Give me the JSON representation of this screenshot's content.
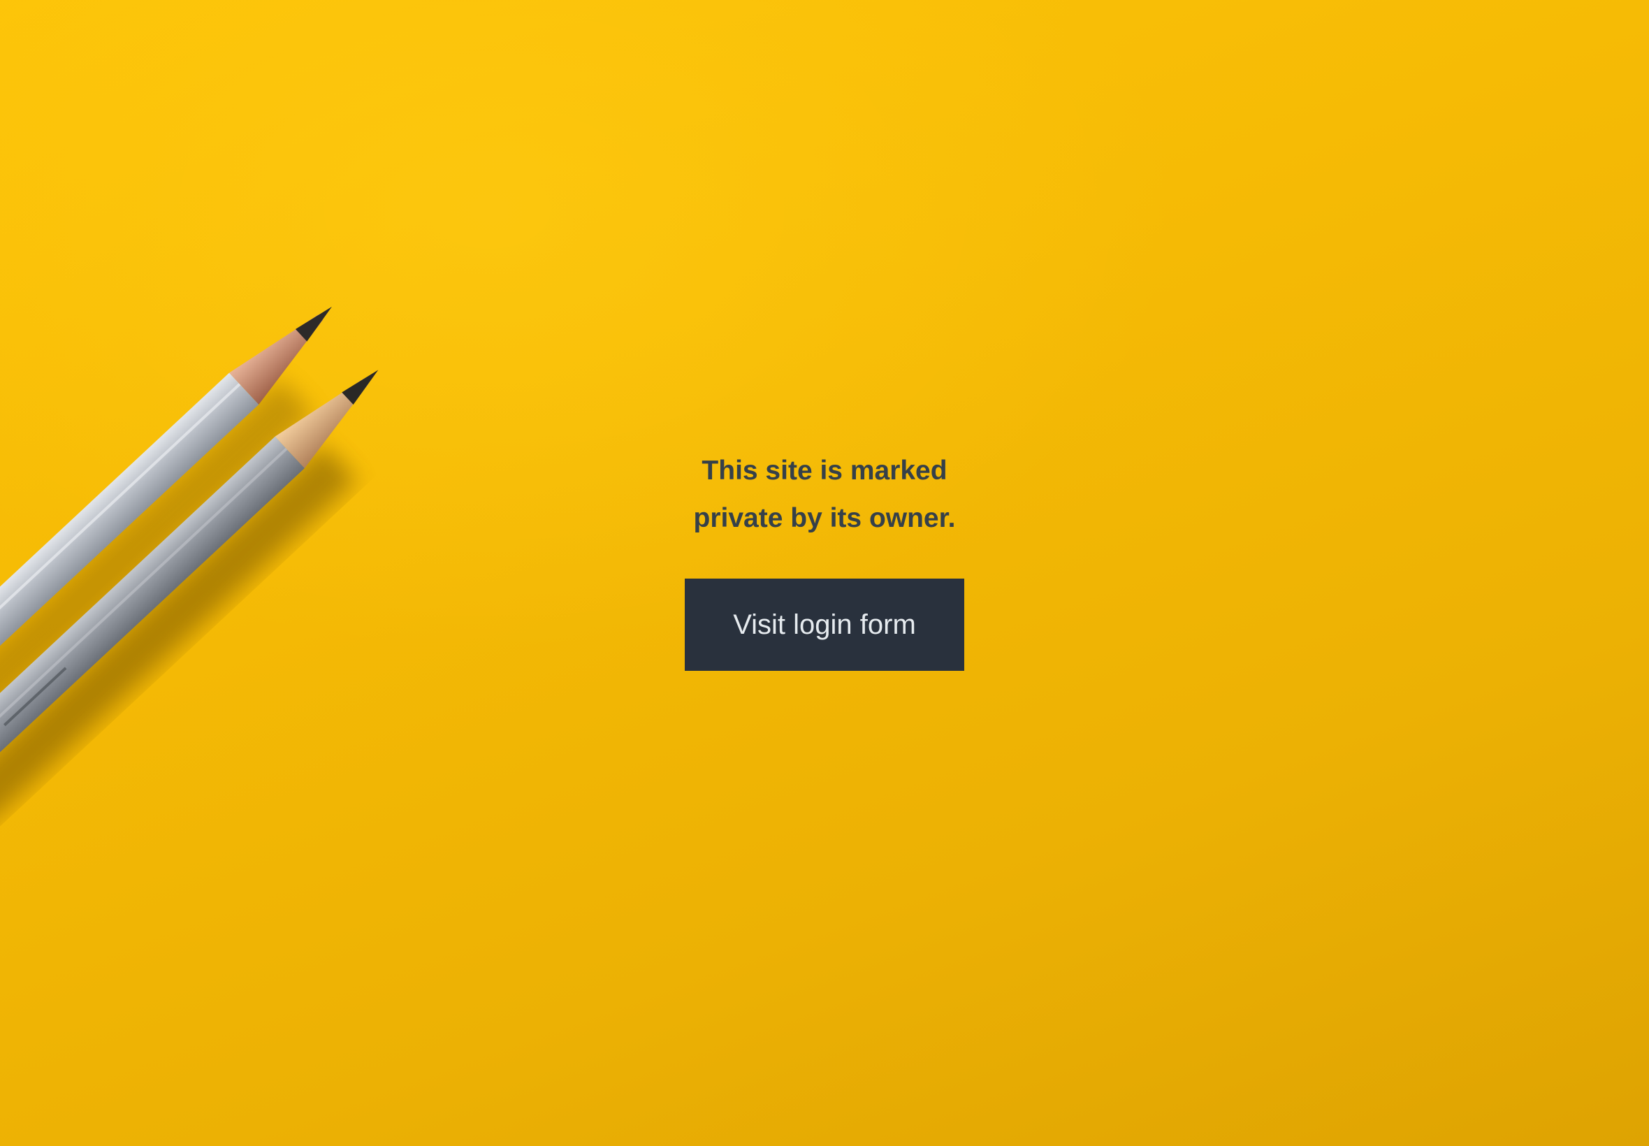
{
  "page": {
    "background_color": "#f4b905",
    "accent_color": "#29313d",
    "text_color": "#354049"
  },
  "notice": {
    "text": "This site is marked private by its owner."
  },
  "login_button": {
    "label": "Visit login form"
  },
  "background_image": {
    "icon": "pencils-photo"
  }
}
